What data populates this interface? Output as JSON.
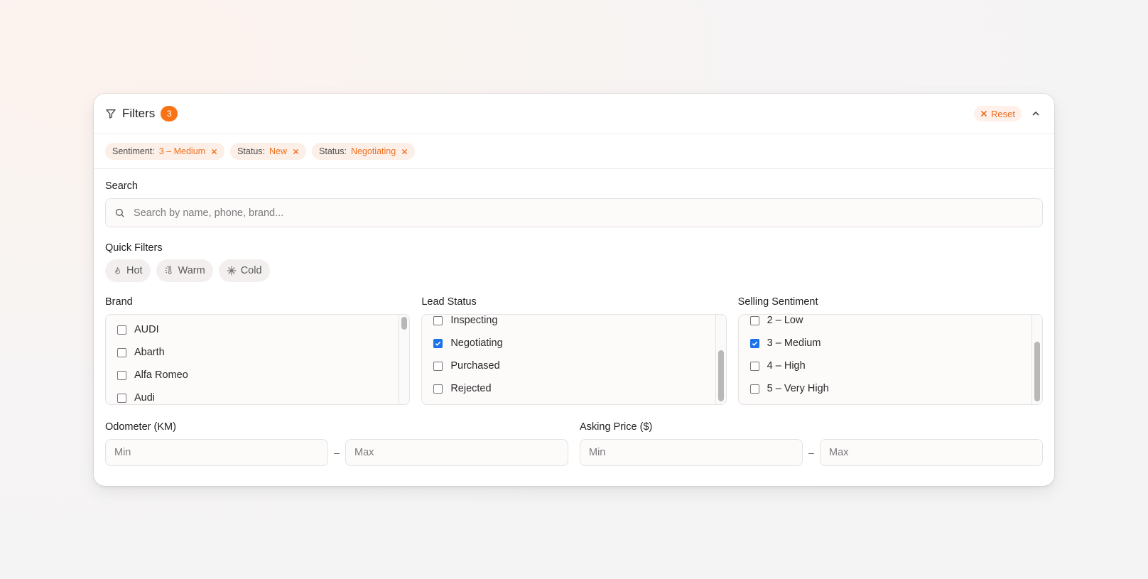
{
  "header": {
    "title": "Filters",
    "count": "3",
    "reset_label": "Reset"
  },
  "active_chips": [
    {
      "key": "Sentiment:",
      "value": "3 – Medium"
    },
    {
      "key": "Status:",
      "value": "New"
    },
    {
      "key": "Status:",
      "value": "Negotiating"
    }
  ],
  "search": {
    "label": "Search",
    "placeholder": "Search by name, phone, brand..."
  },
  "quick_filters": {
    "label": "Quick Filters",
    "items": [
      {
        "label": "Hot",
        "icon": "flame-icon"
      },
      {
        "label": "Warm",
        "icon": "thermometer-sun-icon"
      },
      {
        "label": "Cold",
        "icon": "snowflake-icon"
      }
    ]
  },
  "brand": {
    "label": "Brand",
    "options": [
      {
        "label": "AUDI",
        "checked": false
      },
      {
        "label": "Abarth",
        "checked": false
      },
      {
        "label": "Alfa Romeo",
        "checked": false
      },
      {
        "label": "Audi",
        "checked": false
      }
    ]
  },
  "lead_status": {
    "label": "Lead Status",
    "options": [
      {
        "label": "Inspecting",
        "checked": false
      },
      {
        "label": "Negotiating",
        "checked": true
      },
      {
        "label": "Purchased",
        "checked": false
      },
      {
        "label": "Rejected",
        "checked": false
      }
    ]
  },
  "selling_sentiment": {
    "label": "Selling Sentiment",
    "options": [
      {
        "label": "2 – Low",
        "checked": false
      },
      {
        "label": "3 – Medium",
        "checked": true
      },
      {
        "label": "4 – High",
        "checked": false
      },
      {
        "label": "5 – Very High",
        "checked": false
      }
    ]
  },
  "odometer": {
    "label": "Odometer (KM)",
    "min_placeholder": "Min",
    "max_placeholder": "Max",
    "separator": "–"
  },
  "asking_price": {
    "label": "Asking Price ($)",
    "min_placeholder": "Min",
    "max_placeholder": "Max",
    "separator": "–"
  },
  "colors": {
    "accent": "#f97316",
    "chip_bg": "#fcefe8",
    "checkbox_checked": "#1a73e8"
  }
}
